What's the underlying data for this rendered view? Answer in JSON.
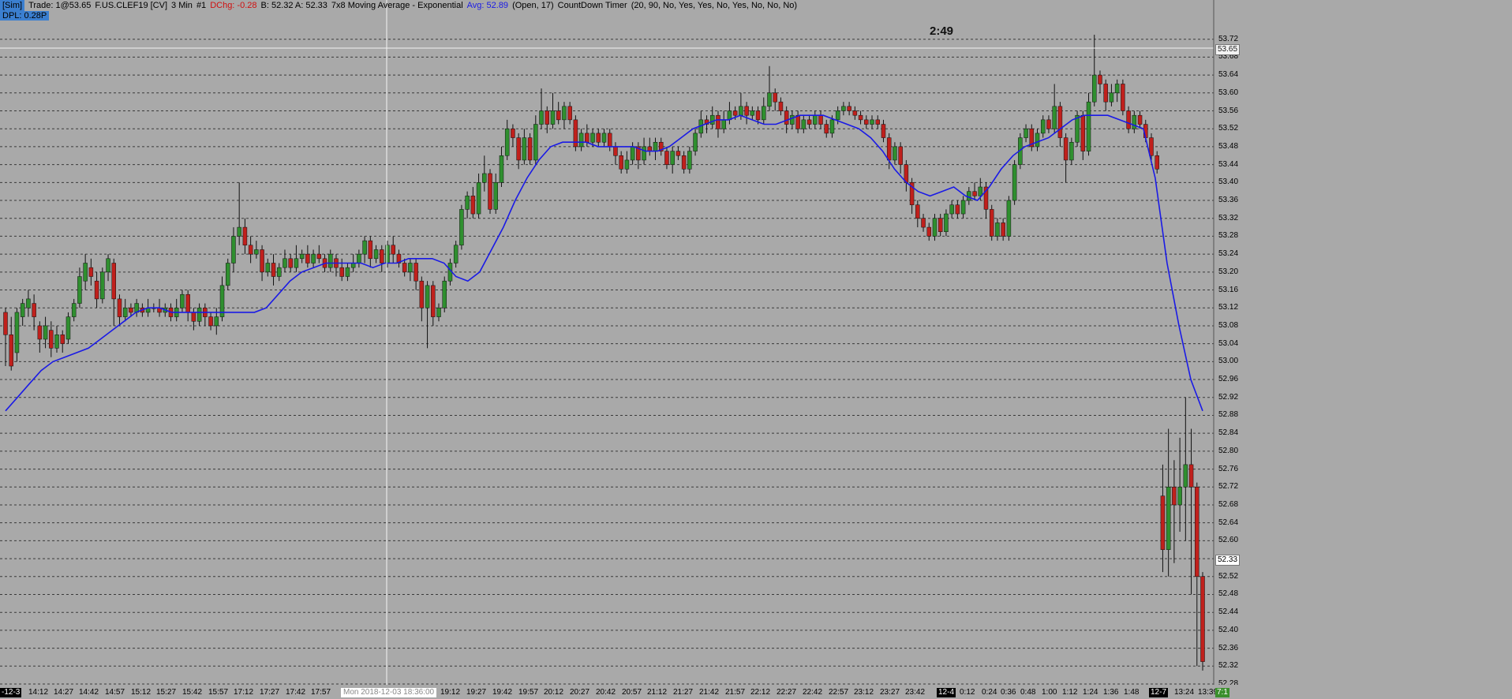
{
  "header": {
    "sim": "[Sim]",
    "trade": "Trade: 1@53.65",
    "instrument": "F.US.CLEF19 [CV]",
    "interval": "3 Min",
    "chart_no": "#1",
    "dchg": "DChg: -0.28",
    "bid_ask": "B: 52.32 A: 52.33",
    "study": "7x8 Moving Average - Exponential",
    "avg": "Avg: 52.89",
    "study_params": "(Open, 17)",
    "timer_study": "CountDown Timer",
    "timer_params": "(20, 90, No, Yes, Yes, No, Yes, No, No, No)"
  },
  "dpl": "DPL: 0.28P",
  "countdown": "2:49",
  "price_labels": {
    "last_trade": "53.65",
    "current": "52.33"
  },
  "time_labels": [
    "14:12",
    "14:27",
    "14:42",
    "14:57",
    "15:12",
    "15:27",
    "15:42",
    "15:57",
    "17:12",
    "17:27",
    "17:42",
    "17:57",
    "19:12",
    "19:27",
    "19:42",
    "19:57",
    "20:12",
    "20:27",
    "20:42",
    "20:57",
    "21:12",
    "21:27",
    "21:42",
    "21:57",
    "22:12",
    "22:27",
    "22:42",
    "22:57",
    "23:12",
    "23:27",
    "23:42",
    "0:12",
    "0:24",
    "0:36",
    "0:48",
    "1:00",
    "1:12",
    "1:24",
    "1:36",
    "1:48",
    "13:24"
  ],
  "time_special": {
    "first": "-12-3",
    "crosshair": "Mon 2018-12-03  18:36:00",
    "day_12_4": "12-4",
    "day_12_7": "12-7",
    "last": "13:39",
    "last_badge": "7:1"
  },
  "colors": {
    "background": "#a9a9a9",
    "up_candle": "#2f8f2f",
    "down_candle": "#c0201c",
    "ema": "#1a1ae6",
    "grid": "#3a3a3a"
  },
  "chart_data": {
    "type": "candlestick",
    "ylim": [
      52.28,
      53.76
    ],
    "price_ticks": [
      "53.72",
      "53.68",
      "53.64",
      "53.60",
      "53.56",
      "53.52",
      "53.48",
      "53.44",
      "53.40",
      "53.36",
      "53.32",
      "53.28",
      "53.24",
      "53.20",
      "53.16",
      "53.12",
      "53.08",
      "53.04",
      "53.00",
      "52.96",
      "52.92",
      "52.88",
      "52.84",
      "52.80",
      "52.76",
      "52.72",
      "52.68",
      "52.64",
      "52.60",
      "52.56",
      "52.52",
      "52.48",
      "52.44",
      "52.40",
      "52.36",
      "52.32",
      "52.28"
    ],
    "candles": [
      [
        53.11,
        53.06,
        53.12,
        52.99
      ],
      [
        53.06,
        52.99,
        53.1,
        52.98
      ],
      [
        53.02,
        53.11,
        53.12,
        53.0
      ],
      [
        53.1,
        53.13,
        53.14,
        53.08
      ],
      [
        53.12,
        53.14,
        53.16,
        53.1
      ],
      [
        53.13,
        53.1,
        53.15,
        53.07
      ],
      [
        53.08,
        53.05,
        53.09,
        53.02
      ],
      [
        53.05,
        53.08,
        53.1,
        53.03
      ],
      [
        53.07,
        53.03,
        53.09,
        53.01
      ],
      [
        53.03,
        53.06,
        53.08,
        53.02
      ],
      [
        53.06,
        53.04,
        53.07,
        53.02
      ],
      [
        53.05,
        53.1,
        53.11,
        53.04
      ],
      [
        53.1,
        53.13,
        53.14,
        53.09
      ],
      [
        53.13,
        53.19,
        53.21,
        53.12
      ],
      [
        53.18,
        53.22,
        53.24,
        53.16
      ],
      [
        53.21,
        53.19,
        53.23,
        53.17
      ],
      [
        53.18,
        53.14,
        53.2,
        53.12
      ],
      [
        53.14,
        53.2,
        53.21,
        53.13
      ],
      [
        53.2,
        53.23,
        53.24,
        53.18
      ],
      [
        53.22,
        53.14,
        53.23,
        53.08
      ],
      [
        53.14,
        53.1,
        53.15,
        53.08
      ],
      [
        53.1,
        53.12,
        53.14,
        53.09
      ],
      [
        53.12,
        53.11,
        53.13,
        53.1
      ],
      [
        53.11,
        53.13,
        53.14,
        53.1
      ],
      [
        53.12,
        53.11,
        53.13,
        53.1
      ],
      [
        53.11,
        53.12,
        53.14,
        53.1
      ],
      [
        53.12,
        53.12,
        53.13,
        53.11
      ],
      [
        53.12,
        53.11,
        53.14,
        53.1
      ],
      [
        53.11,
        53.12,
        53.13,
        53.1
      ],
      [
        53.12,
        53.1,
        53.13,
        53.09
      ],
      [
        53.1,
        53.12,
        53.14,
        53.09
      ],
      [
        53.12,
        53.15,
        53.16,
        53.11
      ],
      [
        53.15,
        53.11,
        53.16,
        53.09
      ],
      [
        53.11,
        53.09,
        53.12,
        53.07
      ],
      [
        53.09,
        53.12,
        53.13,
        53.08
      ],
      [
        53.12,
        53.1,
        53.13,
        53.08
      ],
      [
        53.1,
        53.08,
        53.11,
        53.07
      ],
      [
        53.08,
        53.1,
        53.12,
        53.06
      ],
      [
        53.1,
        53.17,
        53.19,
        53.09
      ],
      [
        53.17,
        53.22,
        53.23,
        53.16
      ],
      [
        53.22,
        53.28,
        53.3,
        53.2
      ],
      [
        53.28,
        53.3,
        53.4,
        53.26
      ],
      [
        53.3,
        53.26,
        53.32,
        53.24
      ],
      [
        53.26,
        53.24,
        53.28,
        53.22
      ],
      [
        53.24,
        53.25,
        53.27,
        53.23
      ],
      [
        53.25,
        53.2,
        53.26,
        53.18
      ],
      [
        53.2,
        53.22,
        53.23,
        53.19
      ],
      [
        53.22,
        53.19,
        53.24,
        53.17
      ],
      [
        53.19,
        53.21,
        53.22,
        53.18
      ],
      [
        53.21,
        53.23,
        53.25,
        53.2
      ],
      [
        53.23,
        53.21,
        53.24,
        53.2
      ],
      [
        53.21,
        53.23,
        53.26,
        53.2
      ],
      [
        53.23,
        53.24,
        53.25,
        53.22
      ],
      [
        53.24,
        53.22,
        53.26,
        53.21
      ],
      [
        53.22,
        53.24,
        53.25,
        53.21
      ],
      [
        53.24,
        53.23,
        53.26,
        53.22
      ],
      [
        53.23,
        53.21,
        53.24,
        53.2
      ],
      [
        53.21,
        53.24,
        53.25,
        53.2
      ],
      [
        53.23,
        53.21,
        53.24,
        53.19
      ],
      [
        53.21,
        53.19,
        53.23,
        53.18
      ],
      [
        53.19,
        53.21,
        53.22,
        53.18
      ],
      [
        53.21,
        53.22,
        53.24,
        53.2
      ],
      [
        53.22,
        53.24,
        53.25,
        53.21
      ],
      [
        53.24,
        53.27,
        53.28,
        53.22
      ],
      [
        53.27,
        53.23,
        53.28,
        53.21
      ],
      [
        53.23,
        53.25,
        53.26,
        53.22
      ],
      [
        53.25,
        53.22,
        53.26,
        53.2
      ],
      [
        53.22,
        53.26,
        53.27,
        53.21
      ],
      [
        53.26,
        53.24,
        53.28,
        53.22
      ],
      [
        53.24,
        53.22,
        53.25,
        53.21
      ],
      [
        53.22,
        53.2,
        53.23,
        53.19
      ],
      [
        53.2,
        53.22,
        53.23,
        53.18
      ],
      [
        53.22,
        53.18,
        53.23,
        53.16
      ],
      [
        53.18,
        53.12,
        53.19,
        53.09
      ],
      [
        53.12,
        53.17,
        53.18,
        53.03
      ],
      [
        53.17,
        53.1,
        53.18,
        53.08
      ],
      [
        53.1,
        53.12,
        53.13,
        53.09
      ],
      [
        53.12,
        53.18,
        53.19,
        53.11
      ],
      [
        53.18,
        53.22,
        53.23,
        53.17
      ],
      [
        53.22,
        53.26,
        53.27,
        53.21
      ],
      [
        53.26,
        53.34,
        53.35,
        53.25
      ],
      [
        53.34,
        53.37,
        53.38,
        53.32
      ],
      [
        53.37,
        53.33,
        53.39,
        53.32
      ],
      [
        53.33,
        53.4,
        53.42,
        53.32
      ],
      [
        53.4,
        53.42,
        53.46,
        53.38
      ],
      [
        53.42,
        53.34,
        53.43,
        53.33
      ],
      [
        53.34,
        53.4,
        53.42,
        53.33
      ],
      [
        53.4,
        53.46,
        53.48,
        53.39
      ],
      [
        53.46,
        53.52,
        53.54,
        53.45
      ],
      [
        53.52,
        53.5,
        53.53,
        53.48
      ],
      [
        53.5,
        53.45,
        53.51,
        53.43
      ],
      [
        53.45,
        53.5,
        53.52,
        53.44
      ],
      [
        53.5,
        53.45,
        53.51,
        53.44
      ],
      [
        53.45,
        53.53,
        53.55,
        53.44
      ],
      [
        53.53,
        53.56,
        53.61,
        53.52
      ],
      [
        53.56,
        53.53,
        53.57,
        53.51
      ],
      [
        53.53,
        53.56,
        53.6,
        53.52
      ],
      [
        53.56,
        53.54,
        53.58,
        53.53
      ],
      [
        53.54,
        53.57,
        53.58,
        53.52
      ],
      [
        53.57,
        53.54,
        53.58,
        53.53
      ],
      [
        53.54,
        53.48,
        53.55,
        53.47
      ],
      [
        53.48,
        53.51,
        53.52,
        53.47
      ],
      [
        53.51,
        53.49,
        53.53,
        53.48
      ],
      [
        53.49,
        53.51,
        53.52,
        53.48
      ],
      [
        53.51,
        53.49,
        53.52,
        53.48
      ],
      [
        53.49,
        53.51,
        53.52,
        53.48
      ],
      [
        53.51,
        53.48,
        53.52,
        53.47
      ],
      [
        53.48,
        53.46,
        53.49,
        53.44
      ],
      [
        53.46,
        53.43,
        53.47,
        53.42
      ],
      [
        53.43,
        53.45,
        53.47,
        53.42
      ],
      [
        53.45,
        53.48,
        53.49,
        53.44
      ],
      [
        53.48,
        53.45,
        53.49,
        53.43
      ],
      [
        53.45,
        53.48,
        53.5,
        53.44
      ],
      [
        53.48,
        53.47,
        53.5,
        53.46
      ],
      [
        53.47,
        53.49,
        53.5,
        53.45
      ],
      [
        53.49,
        53.47,
        53.5,
        53.46
      ],
      [
        53.47,
        53.44,
        53.48,
        53.43
      ],
      [
        53.44,
        53.47,
        53.48,
        53.42
      ],
      [
        53.47,
        53.46,
        53.48,
        53.45
      ],
      [
        53.46,
        53.43,
        53.47,
        53.42
      ],
      [
        53.43,
        53.47,
        53.48,
        53.42
      ],
      [
        53.47,
        53.51,
        53.52,
        53.46
      ],
      [
        53.51,
        53.54,
        53.56,
        53.5
      ],
      [
        53.54,
        53.53,
        53.55,
        53.51
      ],
      [
        53.53,
        53.55,
        53.57,
        53.52
      ],
      [
        53.55,
        53.52,
        53.56,
        53.5
      ],
      [
        53.52,
        53.54,
        53.56,
        53.51
      ],
      [
        53.54,
        53.56,
        53.58,
        53.53
      ],
      [
        53.56,
        53.55,
        53.57,
        53.54
      ],
      [
        53.55,
        53.57,
        53.6,
        53.54
      ],
      [
        53.57,
        53.55,
        53.58,
        53.53
      ],
      [
        53.55,
        53.56,
        53.57,
        53.54
      ],
      [
        53.56,
        53.54,
        53.57,
        53.53
      ],
      [
        53.54,
        53.57,
        53.59,
        53.53
      ],
      [
        53.57,
        53.6,
        53.66,
        53.56
      ],
      [
        53.6,
        53.58,
        53.61,
        53.56
      ],
      [
        53.58,
        53.56,
        53.59,
        53.55
      ],
      [
        53.56,
        53.53,
        53.57,
        53.51
      ],
      [
        53.53,
        53.55,
        53.56,
        53.52
      ],
      [
        53.55,
        53.52,
        53.56,
        53.51
      ],
      [
        53.52,
        53.54,
        53.55,
        53.51
      ],
      [
        53.54,
        53.53,
        53.55,
        53.52
      ],
      [
        53.53,
        53.55,
        53.56,
        53.52
      ],
      [
        53.55,
        53.53,
        53.56,
        53.52
      ],
      [
        53.53,
        53.51,
        53.54,
        53.5
      ],
      [
        53.51,
        53.54,
        53.55,
        53.5
      ],
      [
        53.54,
        53.56,
        53.57,
        53.53
      ],
      [
        53.56,
        53.57,
        53.58,
        53.55
      ],
      [
        53.57,
        53.56,
        53.58,
        53.55
      ],
      [
        53.56,
        53.55,
        53.57,
        53.54
      ],
      [
        53.55,
        53.54,
        53.56,
        53.53
      ],
      [
        53.54,
        53.53,
        53.55,
        53.52
      ],
      [
        53.53,
        53.54,
        53.55,
        53.52
      ],
      [
        53.54,
        53.53,
        53.55,
        53.52
      ],
      [
        53.53,
        53.5,
        53.54,
        53.49
      ],
      [
        53.5,
        53.45,
        53.51,
        53.43
      ],
      [
        53.45,
        53.48,
        53.49,
        53.44
      ],
      [
        53.48,
        53.44,
        53.49,
        53.42
      ],
      [
        53.44,
        53.4,
        53.45,
        53.38
      ],
      [
        53.4,
        53.35,
        53.41,
        53.33
      ],
      [
        53.35,
        53.32,
        53.36,
        53.3
      ],
      [
        53.32,
        53.3,
        53.33,
        53.29
      ],
      [
        53.3,
        53.28,
        53.31,
        53.27
      ],
      [
        53.28,
        53.32,
        53.33,
        53.27
      ],
      [
        53.32,
        53.29,
        53.33,
        53.28
      ],
      [
        53.29,
        53.33,
        53.34,
        53.28
      ],
      [
        53.33,
        53.35,
        53.36,
        53.32
      ],
      [
        53.35,
        53.33,
        53.36,
        53.32
      ],
      [
        53.33,
        53.36,
        53.37,
        53.32
      ],
      [
        53.36,
        53.38,
        53.39,
        53.35
      ],
      [
        53.38,
        53.37,
        53.4,
        53.36
      ],
      [
        53.37,
        53.39,
        53.41,
        53.36
      ],
      [
        53.39,
        53.34,
        53.4,
        53.32
      ],
      [
        53.34,
        53.28,
        53.35,
        53.27
      ],
      [
        53.28,
        53.31,
        53.32,
        53.27
      ],
      [
        53.31,
        53.28,
        53.32,
        53.27
      ],
      [
        53.28,
        53.36,
        53.37,
        53.27
      ],
      [
        53.36,
        53.44,
        53.45,
        53.35
      ],
      [
        53.44,
        53.5,
        53.51,
        53.43
      ],
      [
        53.5,
        53.52,
        53.53,
        53.49
      ],
      [
        53.52,
        53.48,
        53.53,
        53.47
      ],
      [
        53.48,
        53.51,
        53.52,
        53.47
      ],
      [
        53.51,
        53.54,
        53.55,
        53.5
      ],
      [
        53.54,
        53.52,
        53.55,
        53.51
      ],
      [
        53.52,
        53.57,
        53.62,
        53.51
      ],
      [
        53.57,
        53.5,
        53.58,
        53.48
      ],
      [
        53.5,
        53.45,
        53.51,
        53.4
      ],
      [
        53.45,
        53.49,
        53.5,
        53.44
      ],
      [
        53.49,
        53.55,
        53.56,
        53.48
      ],
      [
        53.55,
        53.47,
        53.56,
        53.45
      ],
      [
        53.47,
        53.58,
        53.6,
        53.46
      ],
      [
        53.58,
        53.64,
        53.73,
        53.57
      ],
      [
        53.64,
        53.62,
        53.65,
        53.6
      ],
      [
        53.62,
        53.58,
        53.63,
        53.56
      ],
      [
        53.58,
        53.6,
        53.62,
        53.57
      ],
      [
        53.6,
        53.62,
        53.63,
        53.58
      ],
      [
        53.62,
        53.56,
        53.63,
        53.55
      ],
      [
        53.56,
        53.52,
        53.57,
        53.51
      ],
      [
        53.52,
        53.55,
        53.56,
        53.51
      ],
      [
        53.55,
        53.53,
        53.56,
        53.52
      ],
      [
        53.53,
        53.5,
        53.54,
        53.49
      ],
      [
        53.5,
        53.46,
        53.51,
        53.45
      ],
      [
        53.46,
        53.43,
        53.47,
        53.42
      ],
      [
        52.7,
        52.58,
        52.77,
        52.53
      ],
      [
        52.58,
        52.72,
        52.85,
        52.52
      ],
      [
        52.72,
        52.68,
        52.78,
        52.55
      ],
      [
        52.68,
        52.72,
        52.83,
        52.62
      ],
      [
        52.72,
        52.77,
        52.92,
        52.6
      ],
      [
        52.77,
        52.72,
        52.85,
        52.48
      ],
      [
        52.72,
        52.52,
        52.73,
        52.32
      ],
      [
        52.52,
        52.33,
        52.53,
        52.31
      ]
    ],
    "ema": [
      52.89,
      52.92,
      52.95,
      52.98,
      53.0,
      53.01,
      53.02,
      53.03,
      53.05,
      53.07,
      53.09,
      53.11,
      53.12,
      53.12,
      53.11,
      53.11,
      53.11,
      53.11,
      53.11,
      53.11,
      53.11,
      53.11,
      53.12,
      53.15,
      53.18,
      53.2,
      53.21,
      53.22,
      53.22,
      53.22,
      53.22,
      53.21,
      53.22,
      53.22,
      53.23,
      53.23,
      53.23,
      53.22,
      53.19,
      53.18,
      53.2,
      53.25,
      53.3,
      53.36,
      53.41,
      53.45,
      53.48,
      53.49,
      53.49,
      53.49,
      53.48,
      53.48,
      53.48,
      53.48,
      53.47,
      53.47,
      53.48,
      53.5,
      53.52,
      53.53,
      53.54,
      53.54,
      53.55,
      53.54,
      53.53,
      53.53,
      53.54,
      53.55,
      53.55,
      53.55,
      53.54,
      53.53,
      53.52,
      53.5,
      53.47,
      53.43,
      53.4,
      53.38,
      53.37,
      53.38,
      53.39,
      53.37,
      53.36,
      53.39,
      53.43,
      53.46,
      53.48,
      53.49,
      53.5,
      53.52,
      53.54,
      53.55,
      53.55,
      53.55,
      53.54,
      53.53,
      53.52,
      53.41,
      53.22,
      53.08,
      52.96,
      52.89
    ]
  }
}
